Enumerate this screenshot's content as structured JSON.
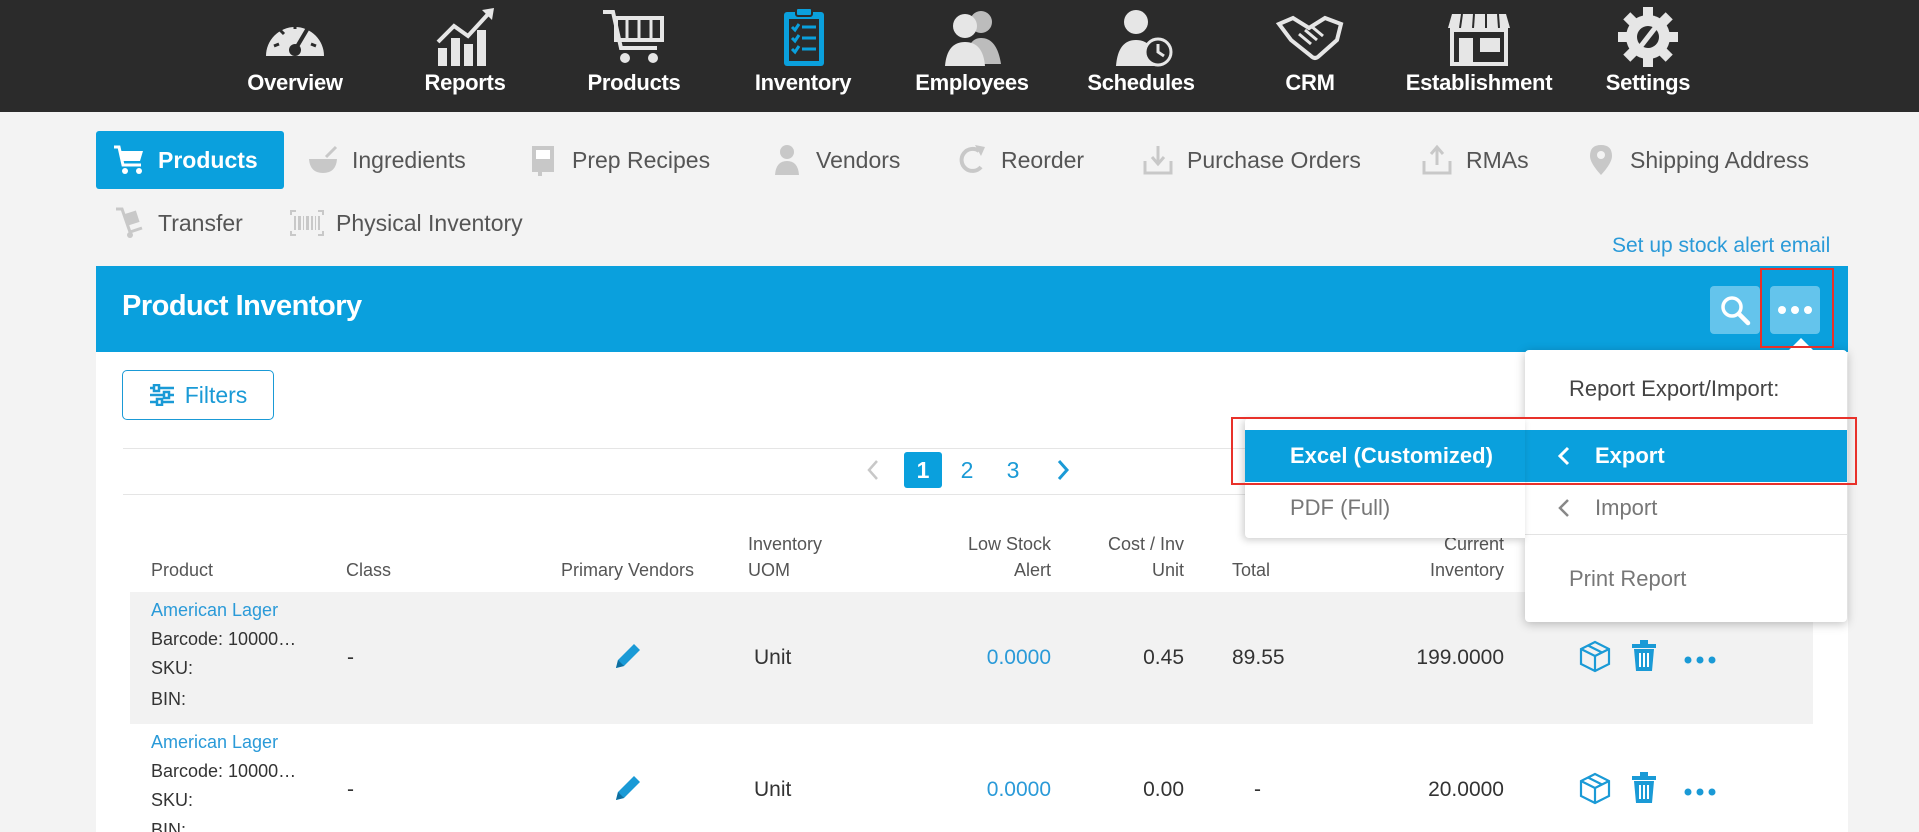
{
  "topnav": {
    "items": [
      {
        "label": "Overview",
        "icon": "speedometer-icon"
      },
      {
        "label": "Reports",
        "icon": "chart-up-icon"
      },
      {
        "label": "Products",
        "icon": "cart-icon"
      },
      {
        "label": "Inventory",
        "icon": "clipboard-checklist-icon",
        "active": true
      },
      {
        "label": "Employees",
        "icon": "people-icon"
      },
      {
        "label": "Schedules",
        "icon": "person-clock-icon"
      },
      {
        "label": "CRM",
        "icon": "handshake-icon"
      },
      {
        "label": "Establishment",
        "icon": "storefront-icon"
      },
      {
        "label": "Settings",
        "icon": "gear-wrench-icon"
      }
    ]
  },
  "subnav": {
    "items": [
      {
        "label": "Products",
        "icon": "cart-icon",
        "active": true
      },
      {
        "label": "Ingredients",
        "icon": "bowl-icon"
      },
      {
        "label": "Prep Recipes",
        "icon": "recipe-book-icon"
      },
      {
        "label": "Vendors",
        "icon": "person-icon"
      },
      {
        "label": "Reorder",
        "icon": "refresh-icon"
      },
      {
        "label": "Purchase Orders",
        "icon": "download-tray-icon"
      },
      {
        "label": "RMAs",
        "icon": "upload-tray-icon"
      },
      {
        "label": "Shipping Address",
        "icon": "map-pin-icon"
      },
      {
        "label": "Transfer",
        "icon": "hand-truck-icon"
      },
      {
        "label": "Physical Inventory",
        "icon": "barcode-icon"
      }
    ]
  },
  "stock_alert_link": "Set up stock alert email",
  "panel": {
    "title": "Product Inventory",
    "filters_label": "Filters"
  },
  "pager": {
    "pages": [
      "1",
      "2",
      "3"
    ],
    "current": "1"
  },
  "table": {
    "headers": {
      "product": "Product",
      "class": "Class",
      "primary_vendors": "Primary Vendors",
      "inventory_uom_1": "Inventory",
      "inventory_uom_2": "UOM",
      "low_stock_1": "Low Stock",
      "low_stock_2": "Alert",
      "cost_1": "Cost / Inv",
      "cost_2": "Unit",
      "total": "Total",
      "current_1": "Current",
      "current_2": "Inventory"
    },
    "rows": [
      {
        "name": "American Lager",
        "barcode": "Barcode: 10000…",
        "sku": "SKU:",
        "bin": "BIN:",
        "class": "-",
        "uom": "Unit",
        "low_stock": "0.0000",
        "cost": "0.45",
        "total": "89.55",
        "current": "199.0000"
      },
      {
        "name": "American Lager",
        "barcode": "Barcode: 10000…",
        "sku": "SKU:",
        "bin": "BIN:",
        "class": "-",
        "uom": "Unit",
        "low_stock": "0.0000",
        "cost": "0.00",
        "total": "-",
        "current": "20.0000"
      }
    ]
  },
  "dropdown": {
    "title": "Report Export/Import:",
    "export_label": "Export",
    "import_label": "Import",
    "print_label": "Print Report"
  },
  "submenu": {
    "excel_label": "Excel (Customized)",
    "pdf_label": "PDF (Full)"
  },
  "colors": {
    "accent": "#0aa0dd",
    "topnav_bg": "#2b2b2b",
    "highlight_box": "#e8312a"
  }
}
